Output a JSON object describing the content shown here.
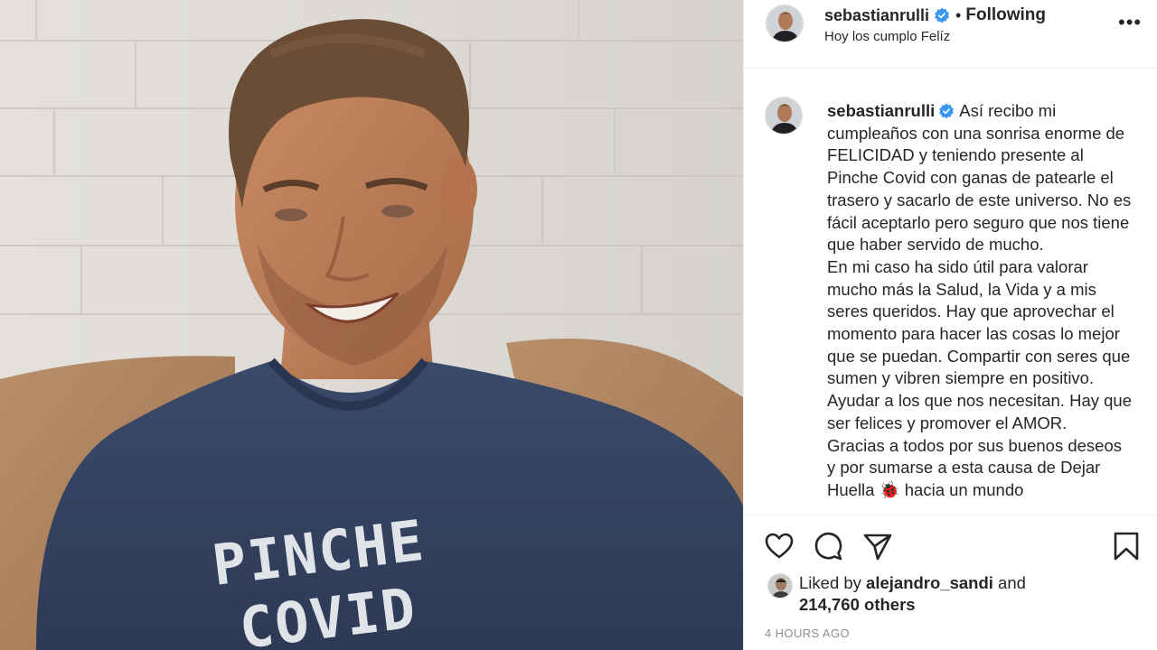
{
  "post": {
    "photo_shirt_text": [
      "PINCHE",
      "COVID"
    ]
  },
  "header": {
    "username": "sebastianrulli",
    "dot": "•",
    "following_label": "Following",
    "location": "Hoy los cumplo Felíz",
    "more_label": "•••"
  },
  "caption": {
    "username": "sebastianrulli",
    "paragraphs": [
      "Así recibo mi cumpleaños con una sonrisa enorme de FELICIDAD y teniendo presente al Pinche Covid con ganas de patearle el trasero y sacarlo de este universo. No es fácil aceptarlo pero seguro que nos tiene que haber servido de mucho.",
      "En mi caso ha sido útil para valorar mucho más la Salud, la Vida y a mis seres queridos. Hay que aprovechar el momento para hacer las cosas lo mejor que se puedan. Compartir con seres que sumen y vibren siempre en positivo. Ayudar a los que nos necesitan. Hay que ser felices y promover el AMOR.",
      "Gracias a todos por sus buenos deseos y por sumarse a esta causa de Dejar Huella 🐞 hacia un mundo"
    ]
  },
  "actions": {
    "like_icon": "heart-icon",
    "comment_icon": "comment-icon",
    "share_icon": "paper-plane-icon",
    "save_icon": "bookmark-icon"
  },
  "likes": {
    "prefix": "Liked by",
    "user": "alejandro_sandi",
    "connector": "and",
    "others": "214,760 others"
  },
  "timestamp": "4 HOURS AGO",
  "colors": {
    "verified_blue": "#3897f0",
    "text": "#262626",
    "muted": "#8e8e8e",
    "divider": "#efefef"
  }
}
